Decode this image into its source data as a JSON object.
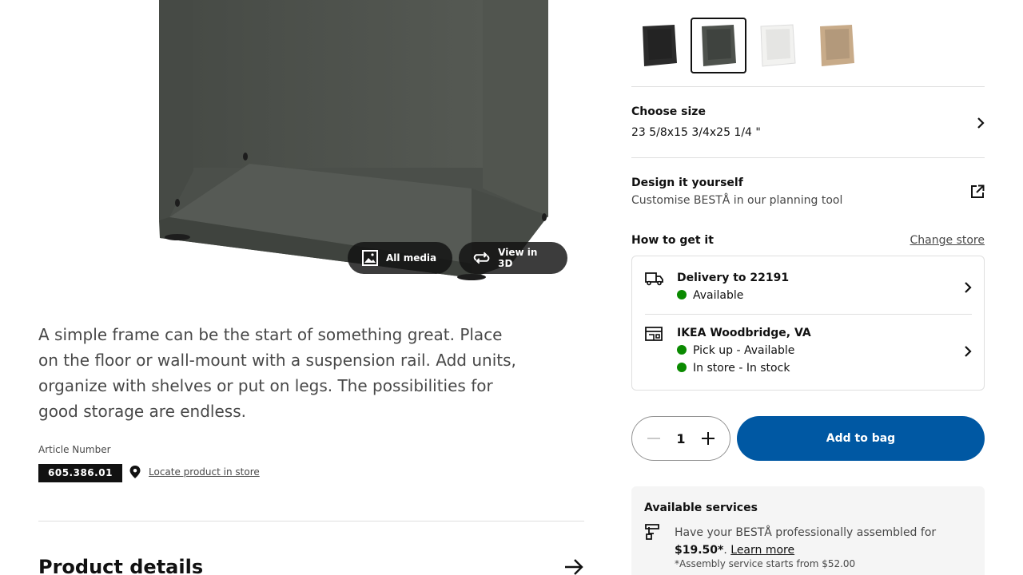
{
  "media": {
    "all_media_label": "All media",
    "view_3d_label": "View in 3D"
  },
  "description": "A simple frame can be the start of something great. Place on the floor or wall-mount with a suspension rail. Add units, organize with shelves or put on legs. The possibilities for good storage are endless.",
  "article": {
    "label": "Article Number",
    "number": "605.386.01",
    "locate_label": "Locate product in store"
  },
  "product_details": {
    "title": "Product details"
  },
  "swatches": [
    {
      "name": "black-brown",
      "color": "#2b2b2b",
      "selected": false
    },
    {
      "name": "dark gray",
      "color": "#4e524d",
      "selected": true
    },
    {
      "name": "white",
      "color": "#f2f2f0",
      "selected": false
    },
    {
      "name": "oak",
      "color": "#c8ab89",
      "selected": false
    }
  ],
  "size": {
    "title": "Choose size",
    "value": "23 5/8x15 3/4x25 1/4 \""
  },
  "design": {
    "title": "Design it yourself",
    "subtitle": "Customise BESTÅ in our planning tool"
  },
  "get_it": {
    "title": "How to get it",
    "change_store": "Change store",
    "delivery": {
      "title": "Delivery to 22191",
      "status": "Available"
    },
    "store": {
      "title": "IKEA Woodbridge, VA",
      "pickup": "Pick up - Available",
      "instore": "In store - In stock"
    },
    "status_color": "#0a8a00"
  },
  "quantity": {
    "value": "1"
  },
  "add_to_bag": {
    "label": "Add to bag",
    "color": "#0058a3"
  },
  "services": {
    "title": "Available services",
    "text_prefix": "Have your BESTÅ professionally assembled for",
    "price": "$19.50*",
    "learn_more": "Learn more",
    "note": "*Assembly service starts from $52.00"
  }
}
